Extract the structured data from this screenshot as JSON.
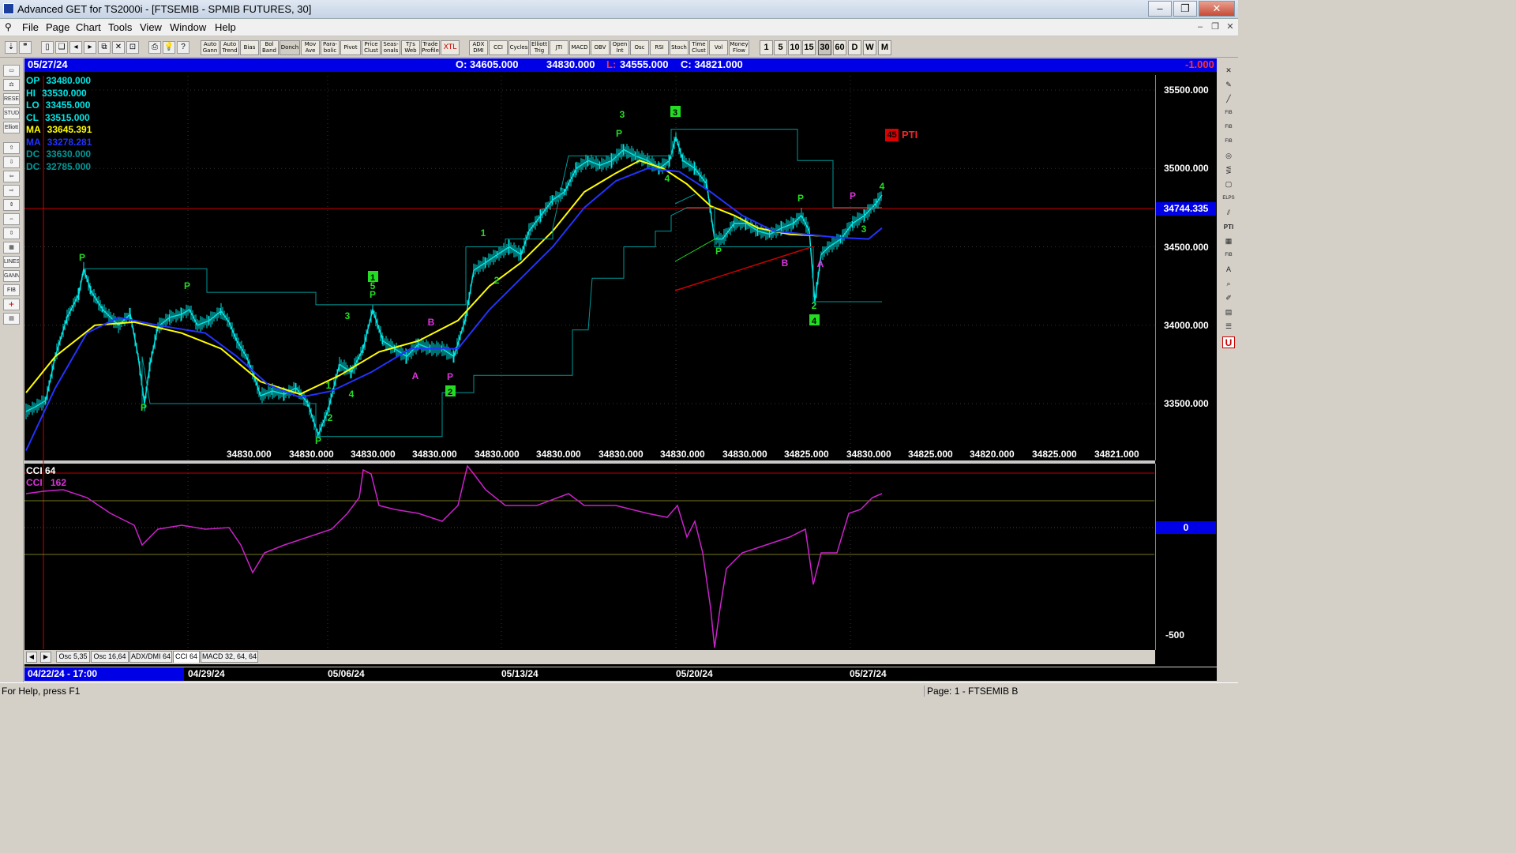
{
  "window": {
    "title": "Advanced GET for TS2000i - [FTSEMIB - SPMIB FUTURES, 30]",
    "buttons": [
      "–",
      "❐",
      "✕"
    ]
  },
  "menu": [
    "File",
    "Page",
    "Chart",
    "Tools",
    "View",
    "Window",
    "Help"
  ],
  "toolbar": {
    "buttons": [
      "Auto Gann",
      "Auto Trend",
      "Bias",
      "Bol Band",
      "Donch",
      "Mov Ave",
      "Para- bolic",
      "Pivot",
      "Price Clust",
      "Seas- onals",
      "TJ's Web",
      "Trade Profile",
      "XTL",
      "ADX DMI",
      "CCI",
      "Cycles",
      "Elliott Trig",
      "JTI",
      "MACD",
      "OBV",
      "Open Int",
      "Osc",
      "RSI",
      "Stoch",
      "Time Clust",
      "Vol",
      "Money Flow"
    ],
    "timeframes": [
      "1",
      "5",
      "10",
      "15",
      "30",
      "60",
      "D",
      "W",
      "M"
    ],
    "selected_timeframe": "30"
  },
  "header": {
    "date": "05/27/24",
    "open": "O: 34605.000",
    "high": "34830.000",
    "low_label": "L:",
    "low": "34555.000",
    "close": "C: 34821.000",
    "change": "-1.000"
  },
  "info_panel": [
    {
      "label": "OP",
      "value": "33480.000",
      "color": "#00e5e5"
    },
    {
      "label": "HI",
      "value": "33530.000",
      "color": "#00e5e5"
    },
    {
      "label": "LO",
      "value": "33455.000",
      "color": "#00e5e5"
    },
    {
      "label": "CL",
      "value": "33515.000",
      "color": "#00e5e5"
    },
    {
      "label": "MA",
      "value": "33645.391",
      "color": "#ffff00"
    },
    {
      "label": "MA",
      "value": "33278.281",
      "color": "#2233ff"
    },
    {
      "label": "DC",
      "value": "33630.000",
      "color": "#009999"
    },
    {
      "label": "DC",
      "value": "32785.000",
      "color": "#009999"
    }
  ],
  "price_axis": {
    "ticks": [
      "35500.000",
      "35000.000",
      "34500.000",
      "34000.000",
      "33500.000"
    ],
    "current_price": "34744.335"
  },
  "close_row": [
    "34830.000",
    "34830.000",
    "34830.000",
    "34830.000",
    "34830.000",
    "34830.000",
    "34830.000",
    "34830.000",
    "34830.000",
    "34825.000",
    "34830.000",
    "34825.000",
    "34820.000",
    "34825.000",
    "34821.000"
  ],
  "pti": {
    "value": "45",
    "label": "PTI"
  },
  "cci": {
    "label1": "CCI 64",
    "label2": "CCI",
    "value2": "162",
    "zero_label": "0",
    "low_label": "-500"
  },
  "tabs": [
    "Osc 5,35",
    "Osc 16,64",
    "ADX/DMI 64",
    "CCI 64",
    "MACD 32, 64, 64"
  ],
  "selected_tab": "CCI 64",
  "dates": {
    "first": "04/22/24 - 17:00",
    "labels": [
      "04/29/24",
      "05/06/24",
      "05/13/24",
      "05/20/24",
      "05/27/24"
    ]
  },
  "status": {
    "help": "For Help, press F1",
    "page": "Page: 1 - FTSEMIB B"
  },
  "colors": {
    "header_blue": "#0000e6",
    "price_cyan": "#00e5e5",
    "ma_yellow": "#ffff00",
    "ma_blue": "#2233ff",
    "donchian": "#009999",
    "cci_magenta": "#cc22cc",
    "wave_green": "#22dd22",
    "pivot_magenta": "#dd33dd",
    "hline_red": "#cc0000"
  },
  "wave_labels": [
    {
      "text": "P",
      "color": "green"
    },
    {
      "text": "P",
      "color": "green"
    },
    {
      "text": "P",
      "color": "green"
    },
    {
      "text": "P",
      "color": "green"
    },
    {
      "text": "1",
      "color": "green"
    },
    {
      "text": "2",
      "color": "green"
    },
    {
      "text": "3",
      "color": "green"
    },
    {
      "text": "4",
      "color": "green"
    },
    {
      "text": "5",
      "color": "green"
    },
    {
      "text": "P",
      "color": "green"
    },
    {
      "text": "A",
      "color": "magenta"
    },
    {
      "text": "B",
      "color": "magenta"
    },
    {
      "text": "P",
      "color": "magenta"
    },
    {
      "text": "1",
      "color": "green"
    },
    {
      "text": "2",
      "color": "green"
    },
    {
      "text": "3",
      "color": "green"
    },
    {
      "text": "P",
      "color": "green"
    },
    {
      "text": "P",
      "color": "green"
    },
    {
      "text": "4",
      "color": "green"
    },
    {
      "text": "P",
      "color": "green"
    },
    {
      "text": "B",
      "color": "magenta"
    },
    {
      "text": "A",
      "color": "magenta"
    },
    {
      "text": "2",
      "color": "green"
    },
    {
      "text": "P",
      "color": "magenta"
    },
    {
      "text": "3",
      "color": "green"
    },
    {
      "text": "4",
      "color": "green"
    },
    {
      "text": "5",
      "color": "green"
    }
  ],
  "wave_boxes": [
    "1",
    "2",
    "3",
    "4"
  ]
}
